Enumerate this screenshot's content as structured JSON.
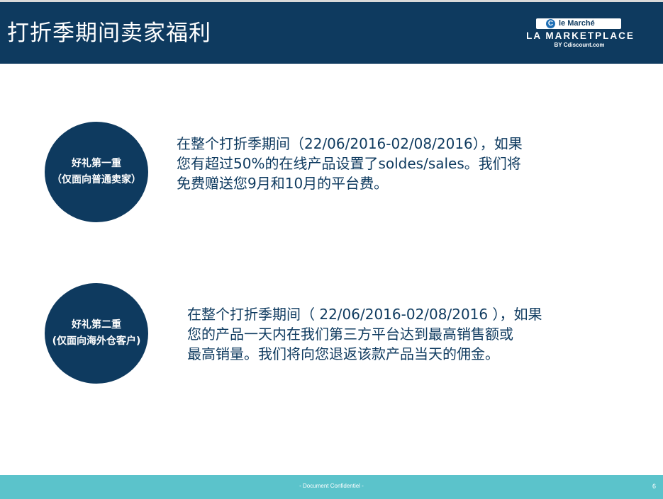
{
  "header": {
    "title": "打折季期间卖家福利",
    "logo": {
      "pill_text": "le Marché",
      "c_letter": "C",
      "main_text": "LA MARKETPLACE",
      "by_text": "BY Cdiscount.com"
    }
  },
  "benefits": [
    {
      "circle_line1": "好礼第一重",
      "circle_line2": "（仅面向普通卖家）",
      "lines": [
        "在整个打折季期间（22/06/2016-02/08/2016），如果",
        "您有超过50%的在线产品设置了soldes/sales。我们将",
        "免费赠送您9月和10月的平台费。"
      ]
    },
    {
      "circle_line1": "好礼第二重",
      "circle_line2": "(仅面向海外仓客户)",
      "lines": [
        "在整个打折季期间（ 22/06/2016-02/08/2016 ），如果",
        "您的产品一天内在我们第三方平台达到最高销售额或",
        "最高销量。我们将向您退返该款产品当天的佣金。"
      ]
    }
  ],
  "footer": {
    "confidential": "- Document Confidentiel -",
    "page_number": "6"
  },
  "colors": {
    "navy": "#0e3a5f",
    "teal": "#5bc3cb"
  }
}
